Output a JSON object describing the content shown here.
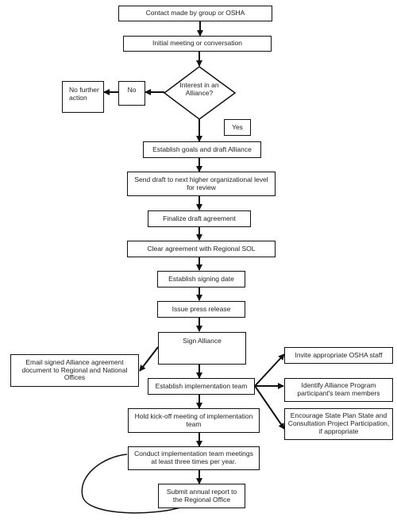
{
  "flowchart": {
    "nodes": {
      "contact": "Contact made by group or OSHA",
      "initial": "Initial meeting or conversation",
      "decision": "Interest in an Alliance?",
      "no_label": "No",
      "no_action": "No further action",
      "yes_label": "Yes",
      "goals": "Establish goals and draft Alliance",
      "send_draft": "Send draft to next higher organizational level for review",
      "finalize": "Finalize draft agreement",
      "clear": "Clear agreement with Regional SOL",
      "signing_date": "Establish signing date",
      "press": "Issue press release",
      "sign": "Sign Alliance",
      "email": "Email signed Alliance agreement document to Regional and National Offices",
      "impl_team": "Establish implementation team",
      "invite": "Invite appropriate OSHA staff",
      "identify": "Identify Alliance Program participant's team members",
      "encourage": "Encourage State Plan State and Consultation Project Participation, if appropriate",
      "kickoff": "Hold kick-off meeting of implementation team",
      "conduct": "Conduct implementation team meetings at least three times per year.",
      "annual": "Submit annual report to the Regional Office"
    }
  }
}
